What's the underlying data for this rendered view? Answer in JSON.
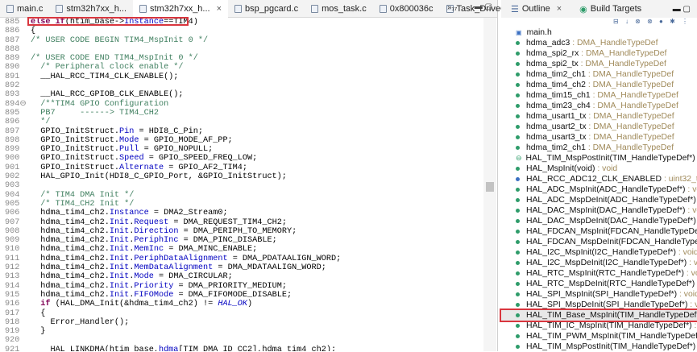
{
  "editor": {
    "tabs": [
      {
        "label": "main.c"
      },
      {
        "label": "stm32h7xx_h..."
      },
      {
        "label": "stm32h7xx_h...",
        "active": true
      },
      {
        "label": "bsp_pgcard.c"
      },
      {
        "label": "mos_task.c"
      },
      {
        "label": "0x800036c"
      },
      {
        "label": "Task_DriveCo..."
      }
    ],
    "more": "»₁₇",
    "close": "×",
    "win_controls": "▬ ▢",
    "lines": [
      {
        "n": "885",
        "s": [
          [
            "kw",
            "else if"
          ],
          [
            "",
            "(htim_base->"
          ],
          [
            "fld",
            "Instance"
          ],
          [
            "",
            "==TIM4)"
          ]
        ]
      },
      {
        "n": "886",
        "s": [
          [
            "",
            "{"
          ]
        ]
      },
      {
        "n": "887",
        "s": [
          [
            "cm",
            "/* USER CODE BEGIN TIM4_MspInit 0 */"
          ]
        ]
      },
      {
        "n": "888",
        "s": []
      },
      {
        "n": "889",
        "s": [
          [
            "cm",
            "/* USER CODE END TIM4_MspInit 0 */"
          ]
        ]
      },
      {
        "n": "890",
        "s": [
          [
            "cm",
            "  /* Peripheral clock enable */"
          ]
        ]
      },
      {
        "n": "891",
        "s": [
          [
            "",
            "  __HAL_RCC_TIM4_CLK_ENABLE();"
          ]
        ]
      },
      {
        "n": "892",
        "s": []
      },
      {
        "n": "893",
        "s": [
          [
            "",
            "  __HAL_RCC_GPIOB_CLK_ENABLE();"
          ]
        ]
      },
      {
        "n": "894⊖",
        "s": [
          [
            "cm",
            "  /**TIM4 GPIO Configuration"
          ]
        ]
      },
      {
        "n": "895",
        "s": [
          [
            "cm",
            "  PB7     ------> TIM4_CH2"
          ]
        ]
      },
      {
        "n": "896",
        "s": [
          [
            "cm",
            "  */"
          ]
        ]
      },
      {
        "n": "897",
        "s": [
          [
            "",
            "  GPIO_InitStruct."
          ],
          [
            "fld",
            "Pin"
          ],
          [
            "",
            " = HDI8_C_Pin;"
          ]
        ]
      },
      {
        "n": "898",
        "s": [
          [
            "",
            "  GPIO_InitStruct."
          ],
          [
            "fld",
            "Mode"
          ],
          [
            "",
            " = GPIO_MODE_AF_PP;"
          ]
        ]
      },
      {
        "n": "899",
        "s": [
          [
            "",
            "  GPIO_InitStruct."
          ],
          [
            "fld",
            "Pull"
          ],
          [
            "",
            " = GPIO_NOPULL;"
          ]
        ]
      },
      {
        "n": "900",
        "s": [
          [
            "",
            "  GPIO_InitStruct."
          ],
          [
            "fld",
            "Speed"
          ],
          [
            "",
            " = GPIO_SPEED_FREQ_LOW;"
          ]
        ]
      },
      {
        "n": "901",
        "s": [
          [
            "",
            "  GPIO_InitStruct."
          ],
          [
            "fld",
            "Alternate"
          ],
          [
            "",
            " = GPIO_AF2_TIM4;"
          ]
        ]
      },
      {
        "n": "902",
        "s": [
          [
            "",
            "  HAL_GPIO_Init(HDI8_C_GPIO_Port, &GPIO_InitStruct);"
          ]
        ]
      },
      {
        "n": "903",
        "s": []
      },
      {
        "n": "904",
        "s": [
          [
            "cm",
            "  /* TIM4 DMA Init */"
          ]
        ]
      },
      {
        "n": "905",
        "s": [
          [
            "cm",
            "  /* TIM4_CH2 Init */"
          ]
        ]
      },
      {
        "n": "906",
        "s": [
          [
            "",
            "  hdma_tim4_ch2."
          ],
          [
            "fld",
            "Instance"
          ],
          [
            "",
            " = DMA2_Stream0;"
          ]
        ]
      },
      {
        "n": "907",
        "s": [
          [
            "",
            "  hdma_tim4_ch2."
          ],
          [
            "fld",
            "Init"
          ],
          [
            "",
            "."
          ],
          [
            "fld",
            "Request"
          ],
          [
            "",
            " = DMA_REQUEST_TIM4_CH2;"
          ]
        ]
      },
      {
        "n": "908",
        "s": [
          [
            "",
            "  hdma_tim4_ch2."
          ],
          [
            "fld",
            "Init"
          ],
          [
            "",
            "."
          ],
          [
            "fld",
            "Direction"
          ],
          [
            "",
            " = DMA_PERIPH_TO_MEMORY;"
          ]
        ]
      },
      {
        "n": "909",
        "s": [
          [
            "",
            "  hdma_tim4_ch2."
          ],
          [
            "fld",
            "Init"
          ],
          [
            "",
            "."
          ],
          [
            "fld",
            "PeriphInc"
          ],
          [
            "",
            " = DMA_PINC_DISABLE;"
          ]
        ]
      },
      {
        "n": "910",
        "s": [
          [
            "",
            "  hdma_tim4_ch2."
          ],
          [
            "fld",
            "Init"
          ],
          [
            "",
            "."
          ],
          [
            "fld",
            "MemInc"
          ],
          [
            "",
            " = DMA_MINC_ENABLE;"
          ]
        ]
      },
      {
        "n": "911",
        "s": [
          [
            "",
            "  hdma_tim4_ch2."
          ],
          [
            "fld",
            "Init"
          ],
          [
            "",
            "."
          ],
          [
            "fld",
            "PeriphDataAlignment"
          ],
          [
            "",
            " = DMA_PDATAALIGN_WORD;"
          ]
        ]
      },
      {
        "n": "912",
        "s": [
          [
            "",
            "  hdma_tim4_ch2."
          ],
          [
            "fld",
            "Init"
          ],
          [
            "",
            "."
          ],
          [
            "fld",
            "MemDataAlignment"
          ],
          [
            "",
            " = DMA_MDATAALIGN_WORD;"
          ]
        ]
      },
      {
        "n": "913",
        "s": [
          [
            "",
            "  hdma_tim4_ch2."
          ],
          [
            "fld",
            "Init"
          ],
          [
            "",
            "."
          ],
          [
            "fld",
            "Mode"
          ],
          [
            "",
            " = DMA_CIRCULAR;"
          ]
        ]
      },
      {
        "n": "914",
        "s": [
          [
            "",
            "  hdma_tim4_ch2."
          ],
          [
            "fld",
            "Init"
          ],
          [
            "",
            "."
          ],
          [
            "fld",
            "Priority"
          ],
          [
            "",
            " = DMA_PRIORITY_MEDIUM;"
          ]
        ]
      },
      {
        "n": "915",
        "s": [
          [
            "",
            "  hdma_tim4_ch2."
          ],
          [
            "fld",
            "Init"
          ],
          [
            "",
            "."
          ],
          [
            "fld",
            "FIFOMode"
          ],
          [
            "",
            " = DMA_FIFOMODE_DISABLE;"
          ]
        ]
      },
      {
        "n": "916",
        "s": [
          [
            "kw",
            "  if"
          ],
          [
            "",
            " (HAL_DMA_Init(&hdma_tim4_ch2) != "
          ],
          [
            "it",
            "HAL_OK"
          ],
          [
            "",
            ")"
          ]
        ]
      },
      {
        "n": "917",
        "s": [
          [
            "",
            "  {"
          ]
        ]
      },
      {
        "n": "918",
        "s": [
          [
            "",
            "    Error_Handler();"
          ]
        ]
      },
      {
        "n": "919",
        "s": [
          [
            "",
            "  }"
          ]
        ]
      },
      {
        "n": "920",
        "s": []
      },
      {
        "n": "921",
        "s": [
          [
            "",
            "    HAL_LINKDMA(htim_base,"
          ],
          [
            "fld",
            "hdma"
          ],
          [
            "",
            "[TIM_DMA_ID_CC2],hdma_tim4_ch2);"
          ]
        ]
      }
    ]
  },
  "outline": {
    "tabs": [
      {
        "label": "Outline",
        "icon": "outline-icon"
      },
      {
        "label": "Build Targets",
        "icon": "build-targets-icon"
      }
    ],
    "toolbar": "⊟ ↓ ⊗ ⊗ ● ✱ ⋮",
    "items": [
      {
        "name": "main.h",
        "type": "",
        "kind": "include"
      },
      {
        "name": "hdma_adc3",
        "type": "DMA_HandleTypeDef",
        "kind": "var"
      },
      {
        "name": "hdma_spi2_rx",
        "type": "DMA_HandleTypeDef",
        "kind": "var"
      },
      {
        "name": "hdma_spi2_tx",
        "type": "DMA_HandleTypeDef",
        "kind": "var"
      },
      {
        "name": "hdma_tim2_ch1",
        "type": "DMA_HandleTypeDef",
        "kind": "var"
      },
      {
        "name": "hdma_tim4_ch2",
        "type": "DMA_HandleTypeDef",
        "kind": "var"
      },
      {
        "name": "hdma_tim15_ch1",
        "type": "DMA_HandleTypeDef",
        "kind": "var"
      },
      {
        "name": "hdma_tim23_ch4",
        "type": "DMA_HandleTypeDef",
        "kind": "var"
      },
      {
        "name": "hdma_usart1_tx",
        "type": "DMA_HandleTypeDef",
        "kind": "var"
      },
      {
        "name": "hdma_usart2_tx",
        "type": "DMA_HandleTypeDef",
        "kind": "var"
      },
      {
        "name": "hdma_usart3_tx",
        "type": "DMA_HandleTypeDef",
        "kind": "var"
      },
      {
        "name": "hdma_tim2_ch1",
        "type": "DMA_HandleTypeDef",
        "kind": "var"
      },
      {
        "name": "HAL_TIM_MspPostInit(TIM_HandleTypeDef*)",
        "type": "void",
        "kind": "decl"
      },
      {
        "name": "HAL_MspInit(void)",
        "type": "void",
        "kind": "fn"
      },
      {
        "name": "HAL_RCC_ADC12_CLK_ENABLED",
        "type": "uint32_t",
        "kind": "static"
      },
      {
        "name": "HAL_ADC_MspInit(ADC_HandleTypeDef*)",
        "type": "void",
        "kind": "fn"
      },
      {
        "name": "HAL_ADC_MspDeInit(ADC_HandleTypeDef*)",
        "type": "void",
        "kind": "fn"
      },
      {
        "name": "HAL_DAC_MspInit(DAC_HandleTypeDef*)",
        "type": "void",
        "kind": "fn"
      },
      {
        "name": "HAL_DAC_MspDeInit(DAC_HandleTypeDef*)",
        "type": "void",
        "kind": "fn"
      },
      {
        "name": "HAL_FDCAN_MspInit(FDCAN_HandleTypeDef*)",
        "type": "void",
        "kind": "fn"
      },
      {
        "name": "HAL_FDCAN_MspDeInit(FDCAN_HandleTypeDef*)",
        "type": "void",
        "kind": "fn"
      },
      {
        "name": "HAL_I2C_MspInit(I2C_HandleTypeDef*)",
        "type": "void",
        "kind": "fn"
      },
      {
        "name": "HAL_I2C_MspDeInit(I2C_HandleTypeDef*)",
        "type": "void",
        "kind": "fn"
      },
      {
        "name": "HAL_RTC_MspInit(RTC_HandleTypeDef*)",
        "type": "void",
        "kind": "fn"
      },
      {
        "name": "HAL_RTC_MspDeInit(RTC_HandleTypeDef*)",
        "type": "void",
        "kind": "fn"
      },
      {
        "name": "HAL_SPI_MspInit(SPI_HandleTypeDef*)",
        "type": "void",
        "kind": "fn"
      },
      {
        "name": "HAL_SPI_MspDeInit(SPI_HandleTypeDef*)",
        "type": "void",
        "kind": "fn"
      },
      {
        "name": "HAL_TIM_Base_MspInit(TIM_HandleTypeDef*)",
        "type": "void",
        "kind": "fn",
        "selected": true
      },
      {
        "name": "HAL_TIM_IC_MspInit(TIM_HandleTypeDef*)",
        "type": "void",
        "kind": "fn"
      },
      {
        "name": "HAL_TIM_PWM_MspInit(TIM_HandleTypeDef*)",
        "type": "void",
        "kind": "fn"
      },
      {
        "name": "HAL_TIM_MspPostInit(TIM_HandleTypeDef*)",
        "type": "void",
        "kind": "fn"
      }
    ],
    "win_controls": "▬ ▢"
  },
  "colors": {
    "highlight": "#d9363e",
    "keyword": "#7f0055",
    "comment": "#3f7f5f",
    "field": "#0000c0"
  }
}
